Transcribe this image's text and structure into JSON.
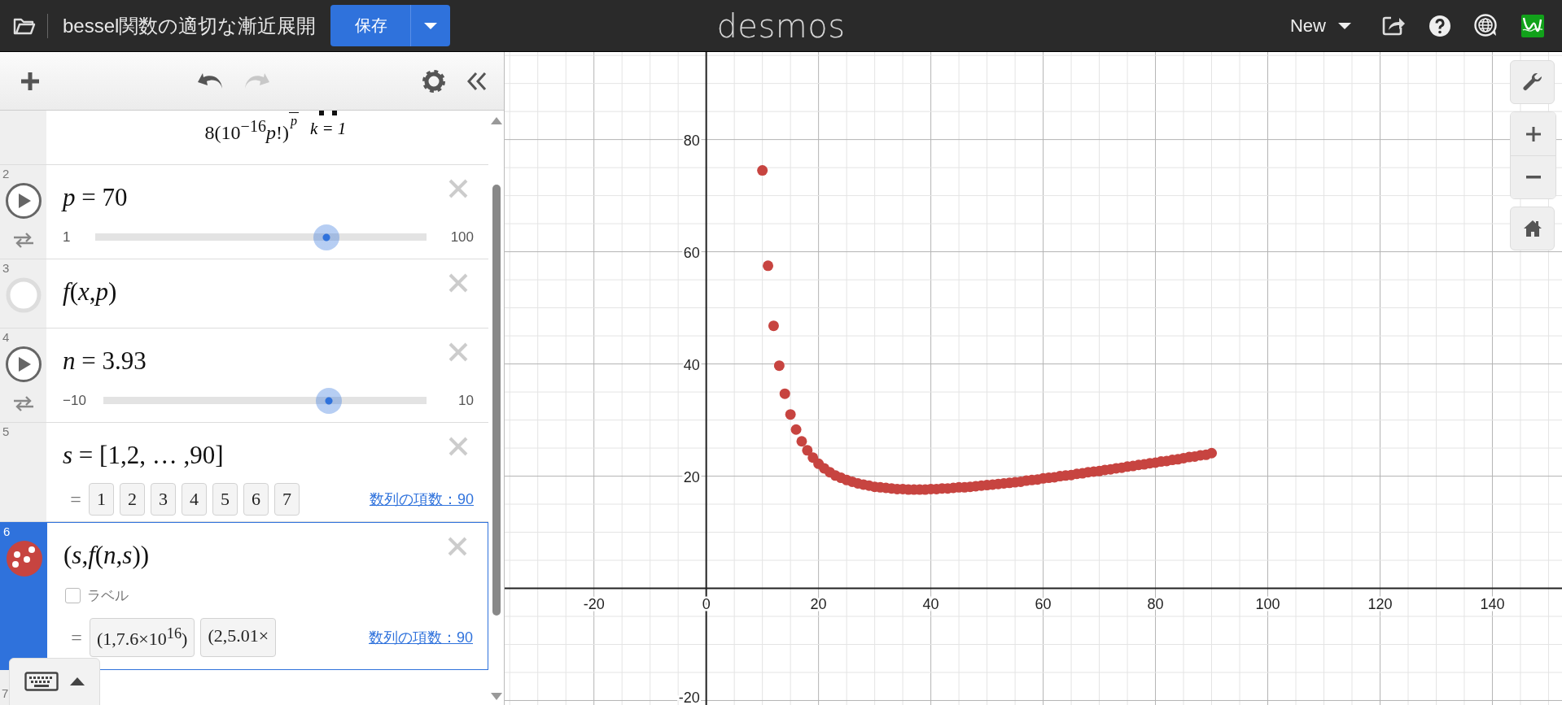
{
  "header": {
    "title": "bessel関数の適切な漸近展開",
    "save_button": "保存",
    "logo": "desmos",
    "new_button": "New"
  },
  "toolbar": {
    "undo": {
      "disabled": false
    },
    "redo": {
      "disabled": true
    }
  },
  "expressions": [
    {
      "kind": "partial",
      "selected": false,
      "math": "8(10$^{−16}$*p*!)",
      "exponent": "p",
      "lower": "k = 1"
    },
    {
      "kind": "slider",
      "selected": false,
      "number": "2",
      "math": "*p* = 70",
      "min": "1",
      "max": "100",
      "level": 0.697
    },
    {
      "kind": "function",
      "selected": false,
      "number": "3",
      "math": "*f*(*x*,*p*)"
    },
    {
      "kind": "slider",
      "selected": false,
      "number": "4",
      "math": "*n* = 3.93",
      "min": "−10",
      "max": "10",
      "level": 0.6965
    },
    {
      "kind": "list",
      "selected": false,
      "number": "5",
      "math": "*s* = [1,2, … ,90]",
      "equals": "=",
      "values": [
        "1",
        "2",
        "3",
        "4",
        "5",
        "6",
        "7"
      ],
      "count_link": "数列の項数：90"
    },
    {
      "kind": "points",
      "selected": true,
      "number": "6",
      "math": "(*s*,*f*(*n*,*s*))",
      "label_option": {
        "text": "ラベル",
        "checked": false
      },
      "equals": "=",
      "values": [
        "(1,7.6×10$^{16}$)",
        "(2,5.01×"
      ],
      "count_link": "数列の項数：90"
    },
    {
      "kind": "empty",
      "selected": false,
      "number": "7"
    }
  ],
  "graph": {
    "chart_data": {
      "type": "scatter",
      "xlim": [
        -35.9,
        152.4
      ],
      "ylim": [
        -20.8,
        95.6
      ],
      "xticks": [
        -20,
        0,
        20,
        40,
        60,
        80,
        100,
        120,
        140
      ],
      "grid": true,
      "yticks": [
        -20,
        20,
        40,
        60,
        80
      ],
      "x": [
        10,
        11,
        12,
        13,
        14,
        15,
        16,
        17,
        18,
        19,
        20,
        21,
        22,
        23,
        24,
        25,
        26,
        27,
        28,
        29,
        30,
        31,
        32,
        33,
        34,
        35,
        36,
        37,
        38,
        39,
        40,
        41,
        42,
        43,
        44,
        45,
        46,
        47,
        48,
        49,
        50,
        51,
        52,
        53,
        54,
        55,
        56,
        57,
        58,
        59,
        60,
        61,
        62,
        63,
        64,
        65,
        66,
        67,
        68,
        69,
        70,
        71,
        72,
        73,
        74,
        75,
        76,
        77,
        78,
        79,
        80,
        81,
        82,
        83,
        84,
        85,
        86,
        87,
        88,
        89,
        90
      ],
      "series": [
        {
          "color": "#c74440",
          "values": [
            74.5,
            57.5,
            46.8,
            39.7,
            34.7,
            31.0,
            28.3,
            26.2,
            24.6,
            23.3,
            22.2,
            21.4,
            20.7,
            20.1,
            19.7,
            19.3,
            19.0,
            18.7,
            18.5,
            18.3,
            18.1,
            18.0,
            17.9,
            17.8,
            17.7,
            17.7,
            17.6,
            17.6,
            17.6,
            17.6,
            17.7,
            17.7,
            17.8,
            17.8,
            17.9,
            18.0,
            18.0,
            18.1,
            18.2,
            18.3,
            18.4,
            18.5,
            18.6,
            18.7,
            18.8,
            18.9,
            19.0,
            19.2,
            19.3,
            19.4,
            19.6,
            19.7,
            19.8,
            20.0,
            20.1,
            20.2,
            20.4,
            20.5,
            20.7,
            20.8,
            20.9,
            21.1,
            21.2,
            21.4,
            21.5,
            21.7,
            21.8,
            22.0,
            22.1,
            22.3,
            22.4,
            22.6,
            22.7,
            22.9,
            23.0,
            23.2,
            23.4,
            23.5,
            23.7,
            23.8,
            24.1
          ]
        }
      ]
    }
  }
}
